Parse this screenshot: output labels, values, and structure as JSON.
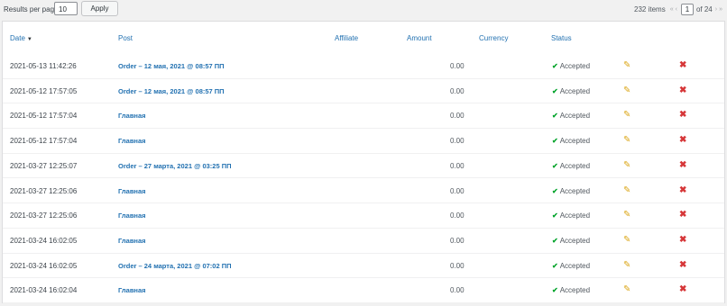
{
  "toolbar": {
    "results_per_page_label": "Results per page",
    "results_per_page_value": "10",
    "apply_label": "Apply"
  },
  "pagination": {
    "items_count": "232 items",
    "first_arrow": "«",
    "prev_arrow": "‹",
    "current_page": "1",
    "of_label": "of 24",
    "next_arrow": "›",
    "last_arrow": "»"
  },
  "columns": {
    "date": "Date",
    "post": "Post",
    "affiliate": "Affiliate",
    "amount": "Amount",
    "currency": "Currency",
    "status": "Status"
  },
  "rows": [
    {
      "date": "2021-05-13 11:42:26",
      "post": "Order – 12 мая, 2021 @ 08:57 ПП",
      "affiliate": "",
      "amount": "0.00",
      "currency": "",
      "status": "Accepted"
    },
    {
      "date": "2021-05-12 17:57:05",
      "post": "Order – 12 мая, 2021 @ 08:57 ПП",
      "affiliate": "",
      "amount": "0.00",
      "currency": "",
      "status": "Accepted"
    },
    {
      "date": "2021-05-12 17:57:04",
      "post": "Главная",
      "affiliate": "",
      "amount": "0.00",
      "currency": "",
      "status": "Accepted"
    },
    {
      "date": "2021-05-12 17:57:04",
      "post": "Главная",
      "affiliate": "",
      "amount": "0.00",
      "currency": "",
      "status": "Accepted"
    },
    {
      "date": "2021-03-27 12:25:07",
      "post": "Order – 27 марта, 2021 @ 03:25 ПП",
      "affiliate": "",
      "amount": "0.00",
      "currency": "",
      "status": "Accepted"
    },
    {
      "date": "2021-03-27 12:25:06",
      "post": "Главная",
      "affiliate": "",
      "amount": "0.00",
      "currency": "",
      "status": "Accepted"
    },
    {
      "date": "2021-03-27 12:25:06",
      "post": "Главная",
      "affiliate": "",
      "amount": "0.00",
      "currency": "",
      "status": "Accepted"
    },
    {
      "date": "2021-03-24 16:02:05",
      "post": "Главная",
      "affiliate": "",
      "amount": "0.00",
      "currency": "",
      "status": "Accepted"
    },
    {
      "date": "2021-03-24 16:02:05",
      "post": "Order – 24 марта, 2021 @ 07:02 ПП",
      "affiliate": "",
      "amount": "0.00",
      "currency": "",
      "status": "Accepted"
    },
    {
      "date": "2021-03-24 16:02:04",
      "post": "Главная",
      "affiliate": "",
      "amount": "0.00",
      "currency": "",
      "status": "Accepted"
    }
  ],
  "icons": {
    "sort": "sort-down-icon",
    "status": "check-icon",
    "edit": "pencil-icon",
    "delete": "delete-x-icon"
  },
  "colors": {
    "link": "#2271b1",
    "accepted": "#00a32a",
    "edit": "#dba617",
    "delete": "#d63638"
  }
}
